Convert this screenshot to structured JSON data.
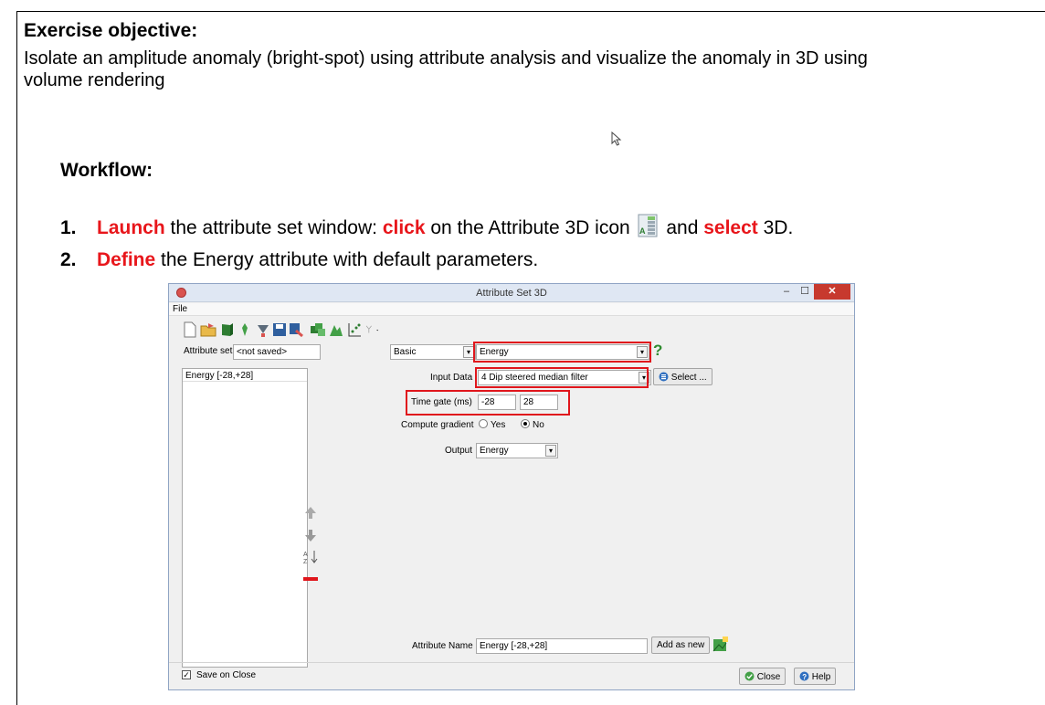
{
  "slide": {
    "objective_title": "Exercise objective:",
    "objective_text": "Isolate an amplitude anomaly (bright-spot) using attribute analysis and visualize the anomaly in 3D using volume rendering",
    "workflow_title": "Workflow:",
    "step1": {
      "num": "1.",
      "kw1": "Launch",
      "t1": " the attribute set window: ",
      "kw2": "click",
      "t2": " on the Attribute 3D icon ",
      "t3": " and ",
      "kw3": "select",
      "t4": " 3D."
    },
    "step2": {
      "num": "2.",
      "kw1": "Define",
      "t1": " the Energy attribute with default parameters."
    },
    "highlight_color": "#e8161b"
  },
  "window": {
    "title": "Attribute Set 3D",
    "menu_file": "File",
    "attribute_set_label": "Attribute set",
    "attribute_set_value": "<not saved>",
    "mode_value": "Basic",
    "attribute_type_value": "Energy",
    "help_glyph": "?",
    "list_items": [
      "Energy [-28,+28]"
    ],
    "input_data_label": "Input Data",
    "input_data_value": "4 Dip steered median filter",
    "select_button": "Select ...",
    "time_gate_label": "Time gate (ms)",
    "time_gate_start": "-28",
    "time_gate_end": "28",
    "compute_gradient_label": "Compute gradient",
    "gradient_yes": "Yes",
    "gradient_no": "No",
    "gradient_selected": "No",
    "output_label": "Output",
    "output_value": "Energy",
    "attribute_name_label": "Attribute Name",
    "attribute_name_value": "Energy [-28,+28]",
    "add_as_new_button": "Add as new",
    "save_on_close_label": "Save on Close",
    "save_on_close_checked": true,
    "close_button": "Close",
    "help_button": "Help",
    "minimize_glyph": "–",
    "maximize_glyph": "☐",
    "close_glyph": "✕"
  }
}
